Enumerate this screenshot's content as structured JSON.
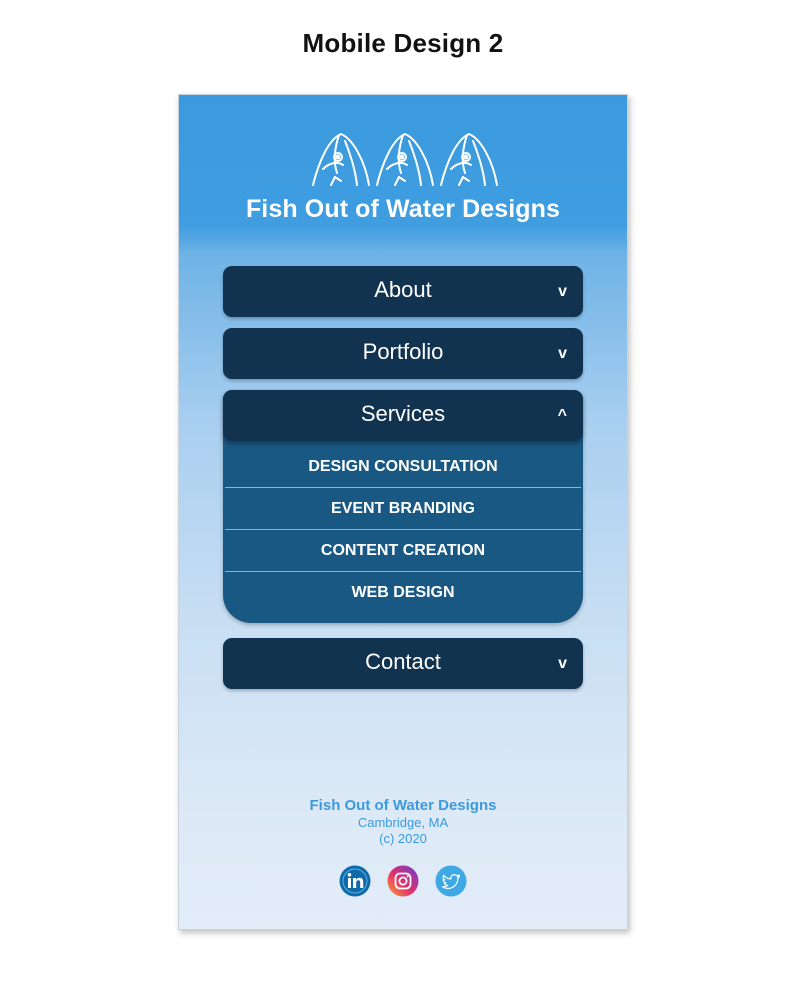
{
  "page": {
    "title": "Mobile Design 2"
  },
  "header": {
    "brand": "Fish Out of Water Designs",
    "logo_icon": "three-fish-logo-icon"
  },
  "nav": {
    "about": {
      "label": "About",
      "arrow": "v",
      "state": "collapsed"
    },
    "portfolio": {
      "label": "Portfolio",
      "arrow": "v",
      "state": "collapsed"
    },
    "services": {
      "label": "Services",
      "arrow": "^",
      "state": "expanded",
      "items": [
        "DESIGN CONSULTATION",
        "EVENT BRANDING",
        "CONTENT CREATION",
        "WEB DESIGN"
      ]
    },
    "contact": {
      "label": "Contact",
      "arrow": "v",
      "state": "collapsed"
    }
  },
  "footer": {
    "name": "Fish Out of Water Designs",
    "city": "Cambridge, MA",
    "copyright": "(c) 2020",
    "socials": [
      "linkedin-icon",
      "instagram-icon",
      "twitter-icon"
    ]
  },
  "colors": {
    "sky_top": "#3b9ade",
    "sky_bottom": "#e3edf8",
    "nav_dark": "#12334f",
    "submenu_blue": "#1a5884",
    "footer_text": "#3b9ade"
  }
}
